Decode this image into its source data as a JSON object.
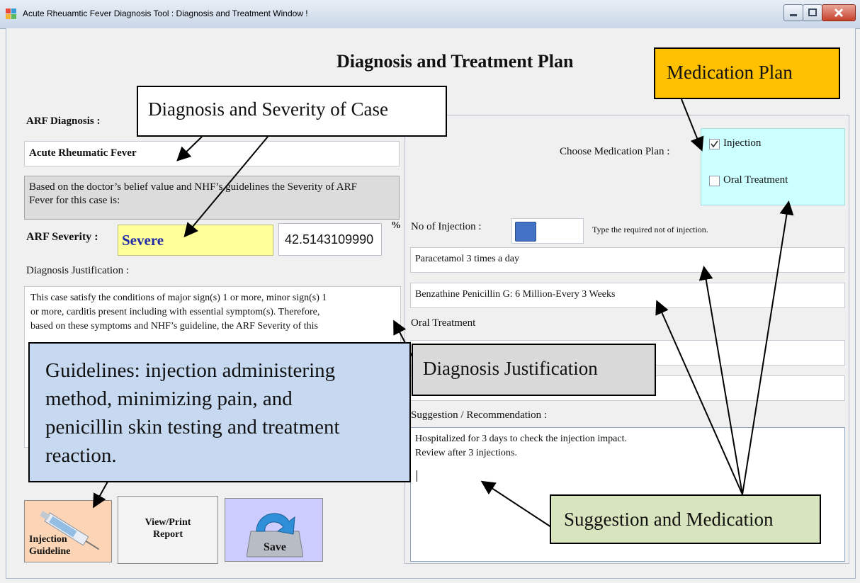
{
  "window": {
    "title": "Acute Rheuamtic Fever Diagnosis Tool : Diagnosis and Treatment Window !"
  },
  "page": {
    "title": "Diagnosis and Treatment Plan"
  },
  "diagnosis": {
    "label": "ARF Diagnosis :",
    "value": "Acute Rheumatic Fever",
    "severity_note_line1": "Based on the doctor’s belief value and NHF’s guidelines the  Severity of ARF",
    "severity_note_line2": "Fever for this case is:",
    "severity_label": "ARF Severity :",
    "severity_value": "Severe",
    "percent_value": "42.5143109990",
    "percent_sign": "%",
    "justification_label": "Diagnosis Justification :",
    "justification_lines": [
      "This case satisfy the conditions of major sign(s) 1 or more, minor sign(s) 1",
      "or more, carditis present including with essential symptom(s). Therefore,",
      "based on these symptoms and NHF’s guideline, the ARF Severity of this"
    ]
  },
  "medication": {
    "choose_label": "Choose Medication Plan :",
    "options": [
      {
        "label": "Injection",
        "checked": true
      },
      {
        "label": "Oral Treatment",
        "checked": false
      }
    ],
    "injection_count_label": "No of Injection :",
    "injection_count_hint": "Type the required not of injection.",
    "injection_line1": "Paracetamol 3 times a day",
    "injection_line2": "Benzathine Penicillin G: 6 Million-Every 3 Weeks",
    "oral_label": "Oral Treatment",
    "oral_line1": "",
    "oral_line2": "",
    "suggestion_label": "Suggestion / Recommendation :",
    "suggestion_lines": [
      "Hospitalized for 3 days to check the injection impact.",
      "Review after 3 injections."
    ]
  },
  "buttons": {
    "injection_guideline_line1": "Injection",
    "injection_guideline_line2": "Guideline",
    "view_print_line1": "View/Print",
    "view_print_line2": "Report",
    "save": "Save"
  },
  "callouts": {
    "diagnosis_severity": "Diagnosis and Severity of Case",
    "medication_plan": "Medication Plan",
    "diagnosis_justification": "Diagnosis Justification",
    "guidelines_lines": [
      "Guidelines: injection administering",
      "method, minimizing pain, and",
      "penicillin skin testing and treatment",
      "reaction."
    ],
    "suggestion_medication": "Suggestion and Medication"
  },
  "colors": {
    "severity_highlight": "#ffff99",
    "severity_text": "#1f2aa6",
    "medication_plan_panel": "#ccffff",
    "callout_orange": "#ffc000",
    "callout_blue": "#c6d9f1",
    "callout_green": "#d7e4bd",
    "callout_gray": "#d9d9d9",
    "save_button_bg": "#ccccff",
    "injection_button_bg": "#fbd5b5"
  }
}
